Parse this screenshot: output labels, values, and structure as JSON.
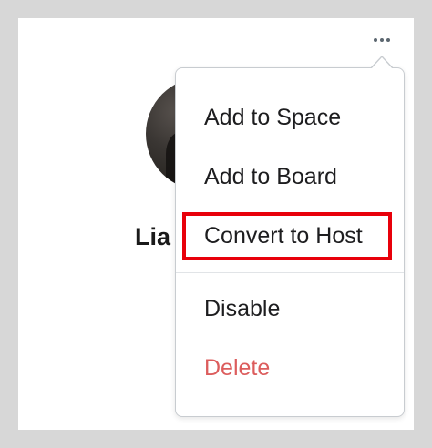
{
  "profile": {
    "name": "Lia"
  },
  "menu": {
    "items": [
      {
        "label": "Add to Space"
      },
      {
        "label": "Add to Board"
      },
      {
        "label": "Convert to Host"
      },
      {
        "label": "Disable"
      },
      {
        "label": "Delete"
      }
    ],
    "more_icon": "more-horizontal-icon",
    "highlighted_item": "Convert to Host"
  },
  "colors": {
    "page_background": "#d7d7d7",
    "card_background": "#ffffff",
    "danger_text": "#dc5d5d",
    "highlight_border": "#e8000a",
    "more_icon_dots": "#5c6770"
  }
}
